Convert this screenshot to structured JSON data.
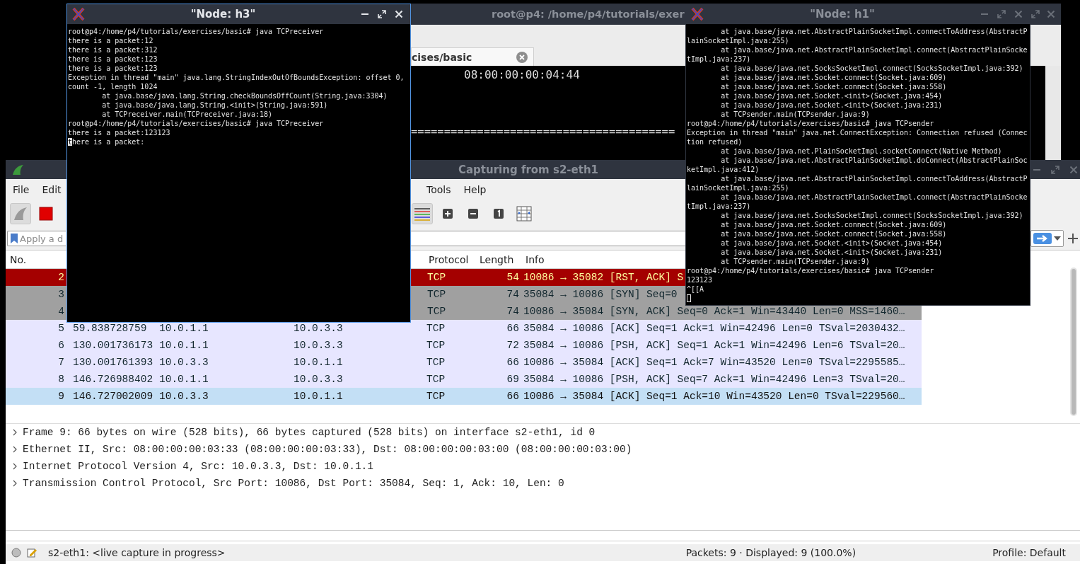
{
  "background_terminal": {
    "title": "root@p4: /home/p4/tutorials/exer",
    "tab": {
      "label": "cises/basic"
    },
    "lines": [
      "08:00:00:00:04:44",
      "========================================"
    ]
  },
  "wireshark": {
    "title": "Capturing from s2-eth1",
    "menu_left": [
      "File",
      "Edit"
    ],
    "menu_right": [
      "Tools",
      "Help"
    ],
    "filter": {
      "placeholder": "Apply a d"
    },
    "columns": {
      "no": "No.",
      "protocol": "Protocol",
      "length": "Length",
      "info": "Info"
    },
    "packets": [
      {
        "no": "2",
        "protocol": "TCP",
        "length": "54",
        "info": "10086 → 35082 [RST, ACK] S",
        "color": "#a40000",
        "selected": false
      },
      {
        "no": "3",
        "protocol": "TCP",
        "length": "74",
        "info": "35084 → 10086 [SYN] Seq=0",
        "color": "#a0a0a0",
        "selected": false
      },
      {
        "no": "4",
        "protocol": "TCP",
        "length": "74",
        "info": "10086 → 35084 [SYN, ACK] Seq=0 Ack=1 Win=43440 Len=0 MSS=1460…",
        "color": "#a0a0a0",
        "selected": false
      },
      {
        "no": "5",
        "time": "59.838728759",
        "source": "10.0.1.1",
        "destination": "10.0.3.3",
        "protocol": "TCP",
        "length": "66",
        "info": "35084 → 10086 [ACK] Seq=1 Ack=1 Win=42496 Len=0 TSval=2030432…",
        "color": "#e7e6ff",
        "selected": false
      },
      {
        "no": "6",
        "time": "130.001736173",
        "source": "10.0.1.1",
        "destination": "10.0.3.3",
        "protocol": "TCP",
        "length": "72",
        "info": "35084 → 10086 [PSH, ACK] Seq=1 Ack=1 Win=42496 Len=6 TSval=20…",
        "color": "#e7e6ff",
        "selected": false
      },
      {
        "no": "7",
        "time": "130.001761393",
        "source": "10.0.3.3",
        "destination": "10.0.1.1",
        "protocol": "TCP",
        "length": "66",
        "info": "10086 → 35084 [ACK] Seq=1 Ack=7 Win=43520 Len=0 TSval=2295585…",
        "color": "#e7e6ff",
        "selected": false
      },
      {
        "no": "8",
        "time": "146.726988402",
        "source": "10.0.1.1",
        "destination": "10.0.3.3",
        "protocol": "TCP",
        "length": "69",
        "info": "35084 → 10086 [PSH, ACK] Seq=7 Ack=1 Win=42496 Len=3 TSval=20…",
        "color": "#e7e6ff",
        "selected": false
      },
      {
        "no": "9",
        "time": "146.727002009",
        "source": "10.0.3.3",
        "destination": "10.0.1.1",
        "protocol": "TCP",
        "length": "66",
        "info": "10086 → 35084 [ACK] Seq=1 Ack=10 Win=43520 Len=0 TSval=229560…",
        "selected": true
      }
    ],
    "details": [
      {
        "text": "Frame 9: 66 bytes on wire (528 bits), 66 bytes captured (528 bits) on interface s2-eth1, id 0",
        "expanded": false
      },
      {
        "text": "Ethernet II, Src: 08:00:00:00:03:33 (08:00:00:00:03:33), Dst: 08:00:00:00:03:00 (08:00:00:00:03:00)",
        "expanded": false
      },
      {
        "text": "Internet Protocol Version 4, Src: 10.0.3.3, Dst: 10.0.1.1",
        "expanded": false
      },
      {
        "text": "Transmission Control Protocol, Src Port: 10086, Dst Port: 35084, Seq: 1, Ack: 10, Len: 0",
        "expanded": false
      }
    ],
    "status_bar": {
      "capture": "s2-eth1: <live capture in progress>",
      "counts": "Packets: 9 · Displayed: 9 (100.0%)",
      "profile": "Profile: Default"
    }
  },
  "node_h3": {
    "title": "\"Node: h3\"",
    "active": true,
    "lines": [
      {
        "text": "root@p4:/home/p4/tutorials/exercises/basic# java TCPreceiver"
      },
      {
        "text": "there is a packet:12"
      },
      {
        "text": "there is a packet:312"
      },
      {
        "text": "there is a packet:123"
      },
      {
        "text": "there is a packet:123"
      },
      {
        "text": "Exception in thread \"main\" java.lang.StringIndexOutOfBoundsException: offset 0,"
      },
      {
        "text": "count -1, length 1024"
      },
      {
        "text": "        at java.base/java.lang.String.checkBoundsOffCount(String.java:3304)"
      },
      {
        "text": "        at java.base/java.lang.String.<init>(String.java:591)"
      },
      {
        "text": "        at TCPreceiver.main(TCPreceiver.java:18)"
      },
      {
        "text": "root@p4:/home/p4/tutorials/exercises/basic# java TCPreceiver"
      },
      {
        "text": "there is a packet:123123"
      },
      {
        "text": "there is a packet:",
        "cursor": true
      }
    ]
  },
  "node_h1": {
    "title": "\"Node: h1\"",
    "active": false,
    "cursor_line": true,
    "lines": [
      {
        "text": "        at java.base/java.net.AbstractPlainSocketImpl.connectToAddress(AbstractP"
      },
      {
        "text": "lainSocketImpl.java:255)"
      },
      {
        "text": "        at java.base/java.net.AbstractPlainSocketImpl.connect(AbstractPlainSocke"
      },
      {
        "text": "tImpl.java:237)"
      },
      {
        "text": "        at java.base/java.net.SocksSocketImpl.connect(SocksSocketImpl.java:392)"
      },
      {
        "text": "        at java.base/java.net.Socket.connect(Socket.java:609)"
      },
      {
        "text": "        at java.base/java.net.Socket.connect(Socket.java:558)"
      },
      {
        "text": "        at java.base/java.net.Socket.<init>(Socket.java:454)"
      },
      {
        "text": "        at java.base/java.net.Socket.<init>(Socket.java:231)"
      },
      {
        "text": "        at TCPsender.main(TCPsender.java:9)"
      },
      {
        "text": "root@p4:/home/p4/tutorials/exercises/basic# java TCPsender"
      },
      {
        "text": "Exception in thread \"main\" java.net.ConnectException: Connection refused (Connec"
      },
      {
        "text": "tion refused)"
      },
      {
        "text": "        at java.base/java.net.PlainSocketImpl.socketConnect(Native Method)"
      },
      {
        "text": "        at java.base/java.net.AbstractPlainSocketImpl.doConnect(AbstractPlainSoc"
      },
      {
        "text": "ketImpl.java:412)"
      },
      {
        "text": "        at java.base/java.net.AbstractPlainSocketImpl.connectToAddress(AbstractP"
      },
      {
        "text": "lainSocketImpl.java:255)"
      },
      {
        "text": "        at java.base/java.net.AbstractPlainSocketImpl.connect(AbstractPlainSocke"
      },
      {
        "text": "tImpl.java:237)"
      },
      {
        "text": "        at java.base/java.net.SocksSocketImpl.connect(SocksSocketImpl.java:392)"
      },
      {
        "text": "        at java.base/java.net.Socket.connect(Socket.java:609)"
      },
      {
        "text": "        at java.base/java.net.Socket.connect(Socket.java:558)"
      },
      {
        "text": "        at java.base/java.net.Socket.<init>(Socket.java:454)"
      },
      {
        "text": "        at java.base/java.net.Socket.<init>(Socket.java:231)"
      },
      {
        "text": "        at TCPsender.main(TCPsender.java:9)"
      },
      {
        "text": "root@p4:/home/p4/tutorials/exercises/basic# java TCPsender"
      },
      {
        "text": "123123"
      },
      {
        "text": "^[[A"
      }
    ]
  }
}
